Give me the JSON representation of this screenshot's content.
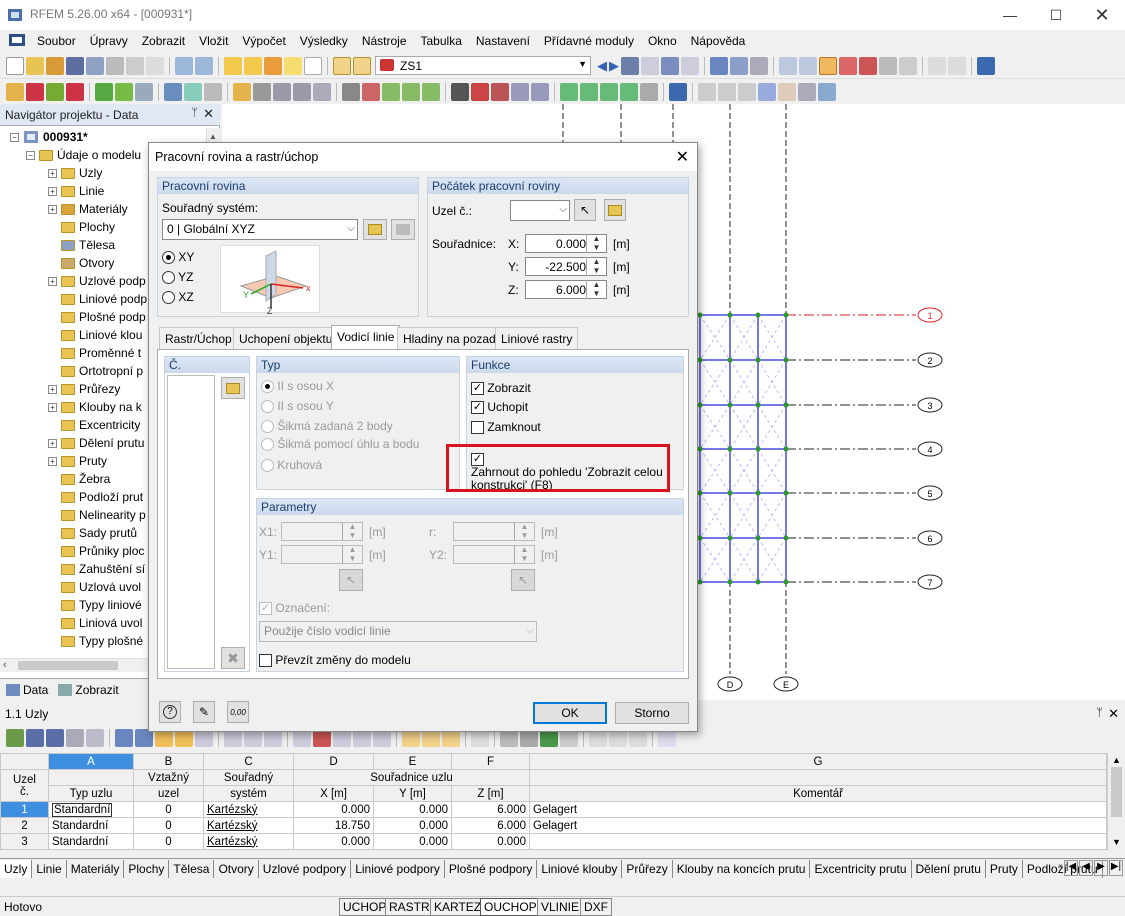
{
  "window": {
    "title": "RFEM 5.26.00 x64 - [000931*]"
  },
  "menu": [
    "Soubor",
    "Úpravy",
    "Zobrazit",
    "Vložit",
    "Výpočet",
    "Výsledky",
    "Nástroje",
    "Tabulka",
    "Nastavení",
    "Přídavné moduly",
    "Okno",
    "Nápověda"
  ],
  "toolbar": {
    "loadcase": "ZS1"
  },
  "navigator": {
    "title": "Navigátor projektu - Data",
    "root": "000931*",
    "model_data": "Údaje o modelu",
    "items": [
      "Uzly",
      "Linie",
      "Materiály",
      "Plochy",
      "Tělesa",
      "Otvory",
      "Uzlové podp",
      "Liniové podp",
      "Plošné podp",
      "Liniové klou",
      "Proměnné t",
      "Ortotropní p",
      "Průřezy",
      "Klouby na k",
      "Excentricity",
      "Dělení prutu",
      "Pruty",
      "Žebra",
      "Podloží prut",
      "Nelinearity p",
      "Sady prutů",
      "Průniky ploc",
      "Zahuštění sí",
      "Uzlová uvol",
      "Typy liniové",
      "Liniová uvol",
      "Typy plošné"
    ],
    "tabs": [
      "Data",
      "Zobrazit"
    ]
  },
  "canvas": {
    "grid_rows": [
      "1",
      "2",
      "3",
      "4",
      "5",
      "6",
      "7"
    ],
    "grid_cols": [
      "D",
      "E"
    ]
  },
  "dialog": {
    "title": "Pracovní rovina a rastr/úchop",
    "workplane": {
      "header": "Pracovní rovina",
      "cs_label": "Souřadný systém:",
      "cs_value": "0 | Globální XYZ",
      "planes": [
        "XY",
        "YZ",
        "XZ"
      ],
      "selected_plane": "XY"
    },
    "origin": {
      "header": "Počátek pracovní roviny",
      "node_label": "Uzel č.:",
      "coords_label": "Souřadnice:",
      "x_label": "X:",
      "x_value": "0.000",
      "y_label": "Y:",
      "y_value": "-22.500",
      "z_label": "Z:",
      "z_value": "6.000",
      "unit": "[m]"
    },
    "tabs": [
      "Rastr/Úchop",
      "Uchopení objektu",
      "Vodicí linie",
      "Hladiny na pozadí",
      "Liniové rastry"
    ],
    "active_tab": "Vodicí linie",
    "list_header": "Č.",
    "type": {
      "header": "Typ",
      "options": [
        "II s osou X",
        "II s osou Y",
        "Šikmá zadaná 2 body",
        "Šikmá pomocí úhlu a bodu",
        "Kruhová"
      ]
    },
    "functions": {
      "header": "Funkce",
      "show": "Zobrazit",
      "snap": "Uchopit",
      "lock": "Zamknout",
      "include_line1": "Zahrnout do pohledu 'Zobrazit celou",
      "include_line2": "konstrukci' (F8)"
    },
    "params": {
      "header": "Parametry",
      "x1": "X1:",
      "y1": "Y1:",
      "r": "r:",
      "y2": "Y2:",
      "unit": "[m]",
      "marking_label": "Označení:",
      "marking_value": "Použije číslo vodicí linie"
    },
    "apply_changes": "Převzít změny do modelu",
    "ok": "OK",
    "cancel": "Storno"
  },
  "table": {
    "title": "1.1 Uzly",
    "col_letters": [
      "A",
      "B",
      "C",
      "D",
      "E",
      "F",
      "G"
    ],
    "h1": [
      "Uzel",
      "",
      "Vztažný",
      "Souřadný",
      "Souřadnice uzlu",
      ""
    ],
    "h2": [
      "č.",
      "Typ uzlu",
      "uzel",
      "systém",
      "X [m]",
      "Y [m]",
      "Z [m]",
      "Komentář"
    ],
    "rows": [
      {
        "no": "1",
        "type": "Standardní",
        "ref": "0",
        "cs": "Kartézský",
        "x": "0.000",
        "y": "0.000",
        "z": "6.000",
        "comment": "Gelagert"
      },
      {
        "no": "2",
        "type": "Standardní",
        "ref": "0",
        "cs": "Kartézský",
        "x": "18.750",
        "y": "0.000",
        "z": "6.000",
        "comment": "Gelagert"
      },
      {
        "no": "3",
        "type": "Standardní",
        "ref": "0",
        "cs": "Kartézský",
        "x": "0.000",
        "y": "0.000",
        "z": "0.000",
        "comment": ""
      }
    ]
  },
  "sheet_tabs": [
    "Uzly",
    "Linie",
    "Materiály",
    "Plochy",
    "Tělesa",
    "Otvory",
    "Uzlové podpory",
    "Liniové podpory",
    "Plošné podpory",
    "Liniové klouby",
    "Průřezy",
    "Klouby na koncích prutu",
    "Excentricity prutu",
    "Dělení prutu",
    "Pruty",
    "Podloží prutu"
  ],
  "status": {
    "text": "Hotovo",
    "buttons": [
      "UCHOP",
      "RASTR",
      "KARTEZ",
      "OUCHOP",
      "VLINIE",
      "DXF"
    ]
  }
}
